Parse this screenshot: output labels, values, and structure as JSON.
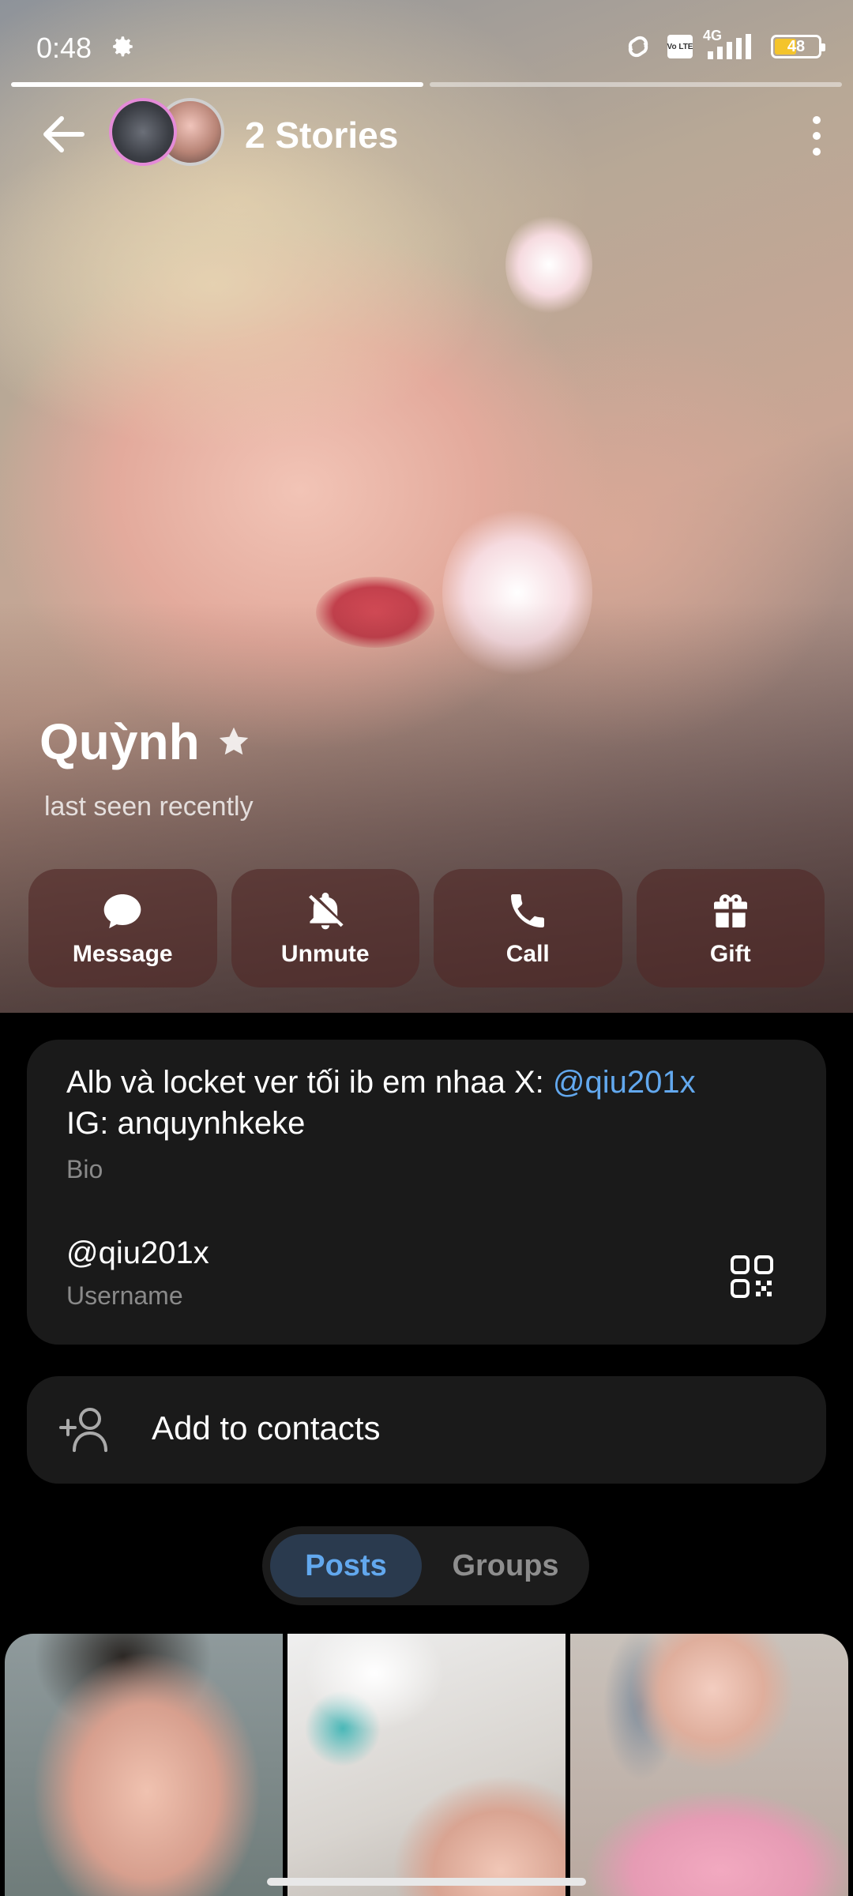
{
  "status_bar": {
    "time": "0:48",
    "network": "4G",
    "volte": "Vo LTE",
    "battery": "48"
  },
  "story_progress": {
    "segments": 2,
    "active_segment": 1
  },
  "header": {
    "title": "2 Stories"
  },
  "profile": {
    "name": "Quỳnh",
    "last_seen": "last seen recently"
  },
  "actions": [
    {
      "label": "Message",
      "icon": "chat-bubble-icon"
    },
    {
      "label": "Unmute",
      "icon": "bell-off-icon"
    },
    {
      "label": "Call",
      "icon": "phone-icon"
    },
    {
      "label": "Gift",
      "icon": "gift-icon"
    }
  ],
  "info": {
    "bio_line1": "Alb và locket ver tối ib em nhaa X: ",
    "bio_mention": "@qiu201x",
    "bio_line2": "IG: anquynhkeke",
    "bio_label": "Bio",
    "username": "@qiu201x",
    "username_label": "Username"
  },
  "add_contact": {
    "label": "Add to contacts"
  },
  "tabs": [
    {
      "label": "Posts",
      "active": true
    },
    {
      "label": "Groups",
      "active": false
    }
  ],
  "colors": {
    "accent": "#62a8ee",
    "card_bg": "#1a1a1a",
    "battery": "#f4c42c"
  }
}
